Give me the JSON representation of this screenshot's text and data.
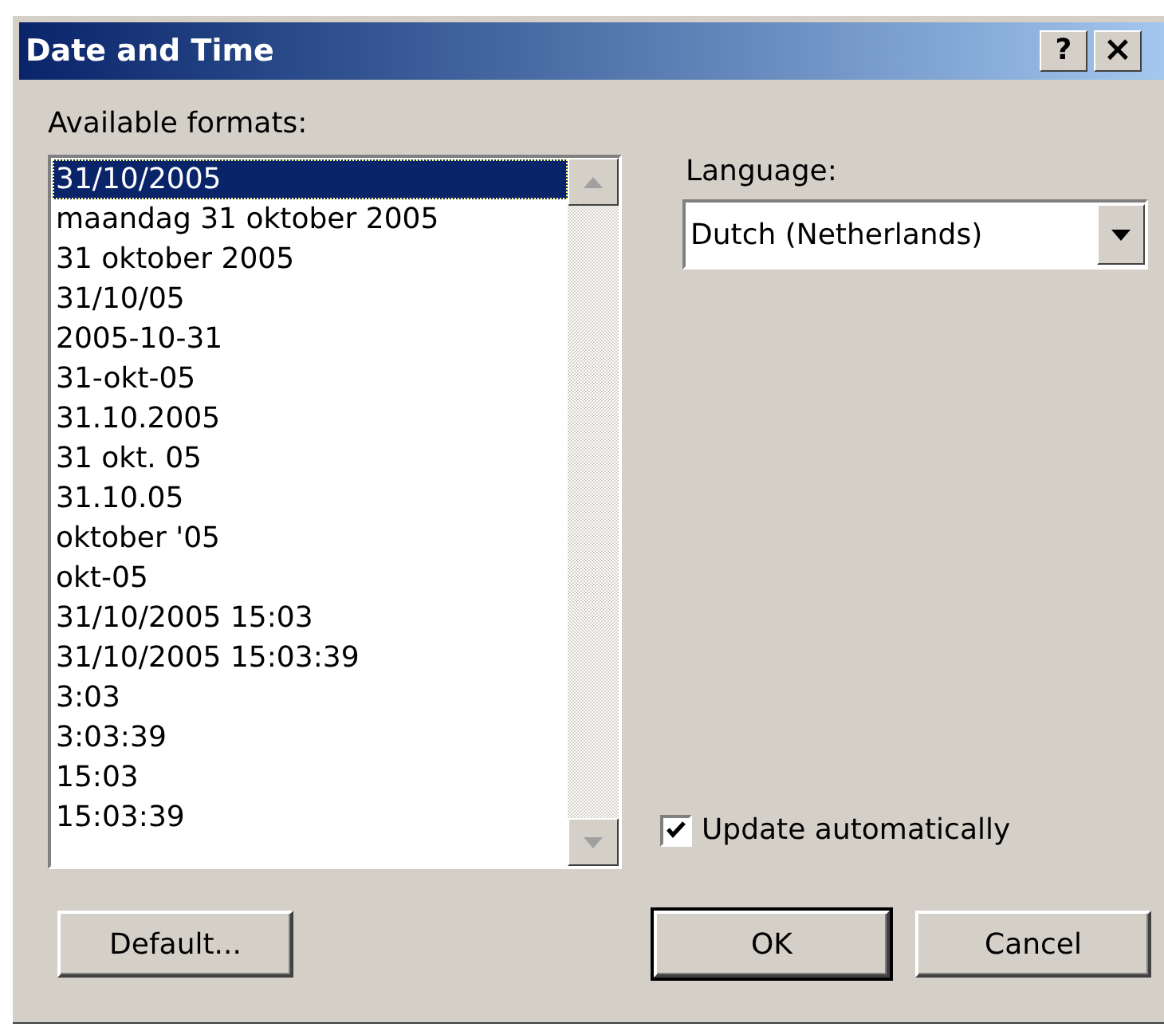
{
  "window": {
    "title": "Date and Time",
    "help_button": "?",
    "close_button": "×"
  },
  "formats": {
    "label": "Available formats:",
    "items": [
      {
        "text": "31/10/2005",
        "selected": true
      },
      {
        "text": "maandag 31 oktober 2005",
        "selected": false
      },
      {
        "text": "31 oktober 2005",
        "selected": false
      },
      {
        "text": "31/10/05",
        "selected": false
      },
      {
        "text": "2005-10-31",
        "selected": false
      },
      {
        "text": "31-okt-05",
        "selected": false
      },
      {
        "text": "31.10.2005",
        "selected": false
      },
      {
        "text": "31 okt. 05",
        "selected": false
      },
      {
        "text": "31.10.05",
        "selected": false
      },
      {
        "text": "oktober '05",
        "selected": false
      },
      {
        "text": "okt-05",
        "selected": false
      },
      {
        "text": "31/10/2005 15:03",
        "selected": false
      },
      {
        "text": "31/10/2005 15:03:39",
        "selected": false
      },
      {
        "text": "3:03",
        "selected": false
      },
      {
        "text": "3:03:39",
        "selected": false
      },
      {
        "text": "15:03",
        "selected": false
      },
      {
        "text": "15:03:39",
        "selected": false
      }
    ]
  },
  "language": {
    "label": "Language:",
    "value": "Dutch (Netherlands)"
  },
  "update_automatically": {
    "label": "Update automatically",
    "checked": true
  },
  "buttons": [
    {
      "label": "Default...",
      "default": false
    },
    {
      "label": "OK",
      "default": true
    },
    {
      "label": "Cancel",
      "default": false
    }
  ]
}
